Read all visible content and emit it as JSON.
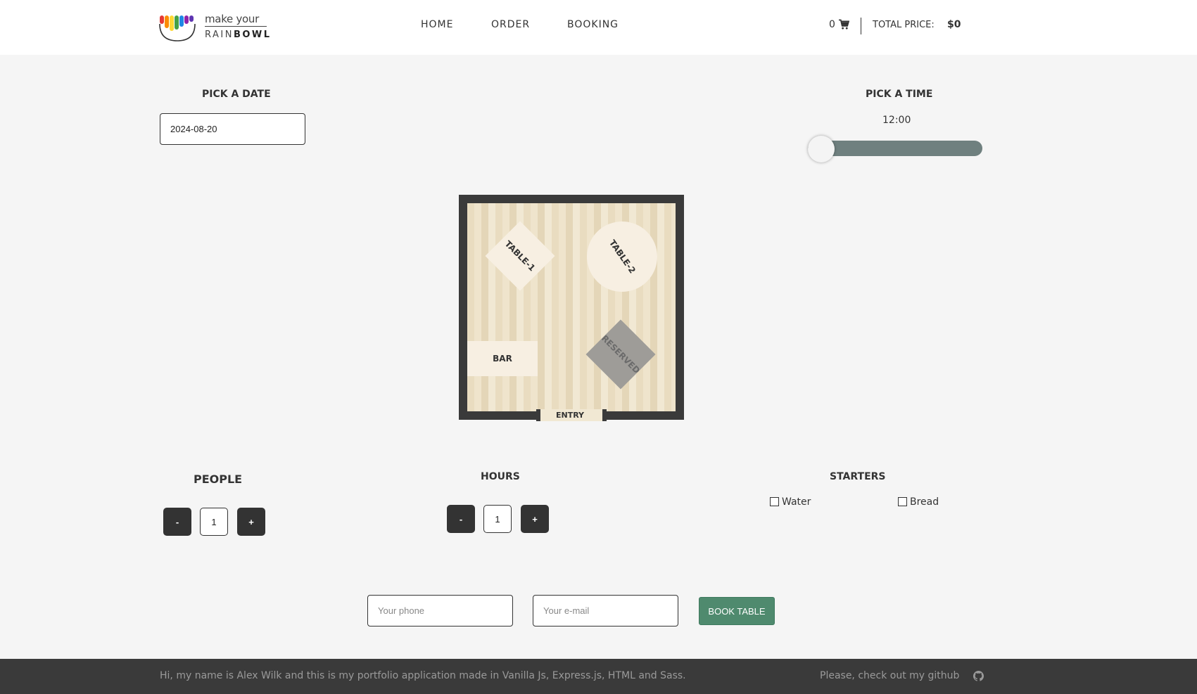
{
  "header": {
    "logo": {
      "top": "make your",
      "rain": "RAIN",
      "bowl": "BOWL"
    },
    "nav": [
      {
        "label": "HOME"
      },
      {
        "label": "ORDER"
      },
      {
        "label": "BOOKING"
      }
    ],
    "cart": {
      "count": "0",
      "icon": "cart-icon",
      "total_label": "TOTAL PRICE:",
      "total_value": "$0"
    }
  },
  "booking": {
    "date": {
      "label": "PICK A DATE",
      "value": "2024-08-20"
    },
    "time": {
      "label": "PICK A TIME",
      "value": "12:00",
      "slider_level": 0
    },
    "floor": {
      "tables": [
        {
          "label": "TABLE-1",
          "shape": "diamond",
          "reserved": false
        },
        {
          "label": "TABLE-2",
          "shape": "circle",
          "reserved": false
        },
        {
          "label": "RESERVED",
          "shape": "diamond",
          "reserved": true
        }
      ],
      "bar_label": "BAR",
      "entry_label": "ENTRY"
    },
    "people": {
      "label": "PEOPLE",
      "minus": "-",
      "value": "1",
      "plus": "+"
    },
    "hours": {
      "label": "HOURS",
      "minus": "-",
      "value": "1",
      "plus": "+"
    },
    "starters": {
      "label": "STARTERS",
      "items": [
        {
          "label": "Water",
          "checked": false
        },
        {
          "label": "Bread",
          "checked": false
        }
      ]
    },
    "form": {
      "phone_placeholder": "Your phone",
      "email_placeholder": "Your e-mail",
      "submit": "BOOK TABLE"
    }
  },
  "footer": {
    "about": "Hi, my name is Alex Wilk and this is my portfolio application made in Vanilla Js, Express.js, HTML and Sass.",
    "github_text": "Please, check out my github",
    "github_icon": "github-icon"
  },
  "colors": {
    "accent": "#4f8a6e",
    "slider": "#6f807f",
    "dark": "#3a3a3a"
  }
}
